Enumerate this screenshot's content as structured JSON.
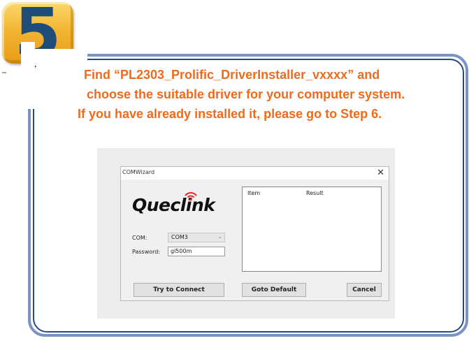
{
  "step": {
    "number": "5"
  },
  "instructions": {
    "line1": "Find “PL2303_Prolific_DriverInstaller_vxxxx” and",
    "line2": "choose the suitable driver for your computer system.",
    "line3": "If you have already installed it, please go to Step 6."
  },
  "window": {
    "title": "COMWizard",
    "close_glyph": "✕",
    "logo_text": "Queclink",
    "com_label": "COM:",
    "com_value": "COM3",
    "password_label": "Password:",
    "password_value": "gl500m",
    "results_columns": [
      "Item",
      "Result"
    ],
    "buttons": {
      "connect": "Try to Connect",
      "goto_default": "Goto Default",
      "cancel": "Cancel"
    }
  },
  "colors": {
    "instruction_text": "#f06a1c",
    "badge_number": "#1f4d7a",
    "frame": "#234a84",
    "badge": "#f2b533"
  },
  "icons": {
    "logo_signal": "wifi-signal-icon",
    "dropdown": "chevron-down-icon",
    "close": "close-icon"
  }
}
